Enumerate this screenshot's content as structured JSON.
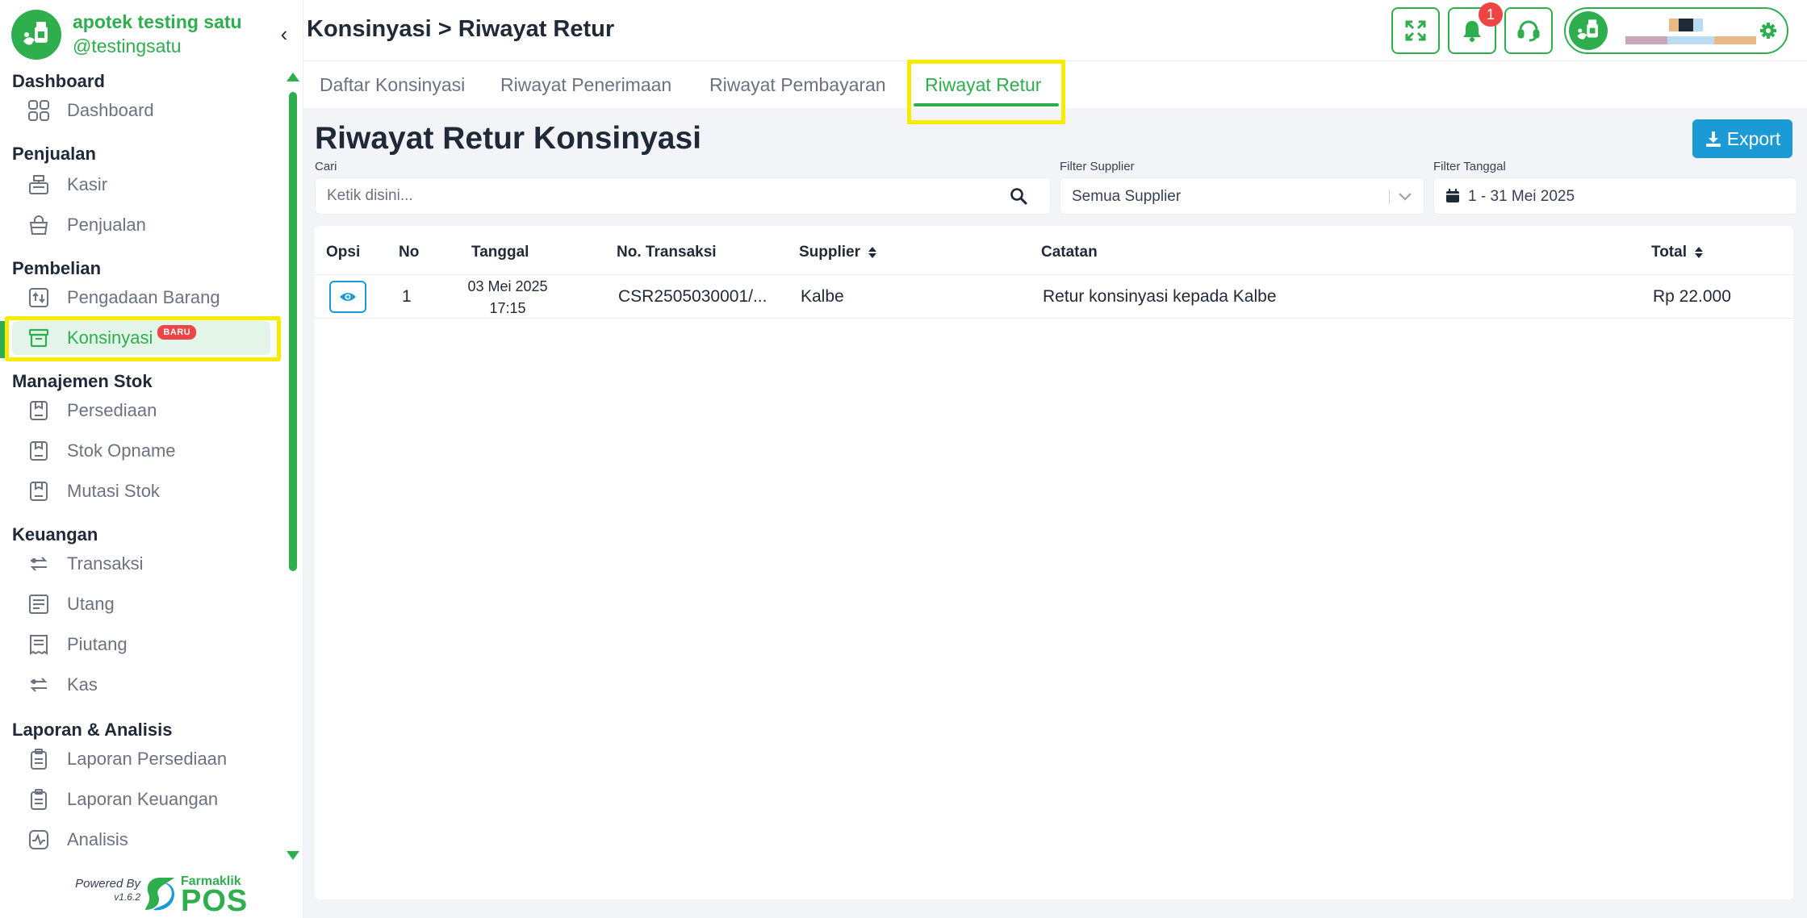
{
  "brand": {
    "name": "apotek testing satu",
    "handle": "@testingsatu"
  },
  "sidebar": {
    "sections": [
      {
        "title": "Dashboard",
        "items": [
          {
            "label": "Dashboard",
            "icon": "grid-icon"
          }
        ]
      },
      {
        "title": "Penjualan",
        "items": [
          {
            "label": "Kasir",
            "icon": "cash-register-icon"
          },
          {
            "label": "Penjualan",
            "icon": "basket-icon"
          }
        ]
      },
      {
        "title": "Pembelian",
        "items": [
          {
            "label": "Pengadaan Barang",
            "icon": "procurement-icon"
          },
          {
            "label": "Konsinyasi",
            "icon": "archive-box-icon",
            "badge": "BARU",
            "active": true
          }
        ]
      },
      {
        "title": "Manajemen Stok",
        "items": [
          {
            "label": "Persediaan",
            "icon": "stock-icon"
          },
          {
            "label": "Stok Opname",
            "icon": "stock-icon"
          },
          {
            "label": "Mutasi Stok",
            "icon": "stock-icon"
          }
        ]
      },
      {
        "title": "Keuangan",
        "items": [
          {
            "label": "Transaksi",
            "icon": "transfer-icon"
          },
          {
            "label": "Utang",
            "icon": "document-list-icon"
          },
          {
            "label": "Piutang",
            "icon": "receipt-icon"
          },
          {
            "label": "Kas",
            "icon": "transfer-icon"
          }
        ]
      },
      {
        "title": "Laporan & Analisis",
        "items": [
          {
            "label": "Laporan Persediaan",
            "icon": "clipboard-icon"
          },
          {
            "label": "Laporan Keuangan",
            "icon": "clipboard-icon"
          },
          {
            "label": "Analisis",
            "icon": "activity-icon"
          }
        ]
      }
    ],
    "footer": {
      "powered_by": "Powered By",
      "version": "v1.6.2",
      "logo_small": "Farmaklik",
      "logo_big": "POS"
    }
  },
  "header": {
    "title": "Konsinyasi > Riwayat Retur",
    "notification_count": "1"
  },
  "tabs": [
    {
      "label": "Daftar Konsinyasi"
    },
    {
      "label": "Riwayat Penerimaan"
    },
    {
      "label": "Riwayat Pembayaran"
    },
    {
      "label": "Riwayat Retur",
      "active": true
    }
  ],
  "page": {
    "section_title": "Riwayat Retur Konsinyasi",
    "export_label": "Export",
    "search": {
      "label": "Cari",
      "placeholder": "Ketik disini..."
    },
    "supplier_filter": {
      "label": "Filter Supplier",
      "value": "Semua Supplier"
    },
    "date_filter": {
      "label": "Filter Tanggal",
      "value": "1 - 31 Mei 2025"
    }
  },
  "table": {
    "columns": [
      "Opsi",
      "No",
      "Tanggal",
      "No. Transaksi",
      "Supplier",
      "Catatan",
      "Total"
    ],
    "rows": [
      {
        "no": "1",
        "date": "03 Mei 2025",
        "time": "17:15",
        "transaction_no": "CSR2505030001/...",
        "supplier": "Kalbe",
        "note": "Retur konsinyasi kepada Kalbe",
        "total": "Rp 22.000"
      }
    ]
  },
  "colors": {
    "primary": "#2fae4e",
    "accent_blue": "#1b9ad6",
    "badge_red": "#ef4444",
    "highlight": "#f5ec00"
  }
}
